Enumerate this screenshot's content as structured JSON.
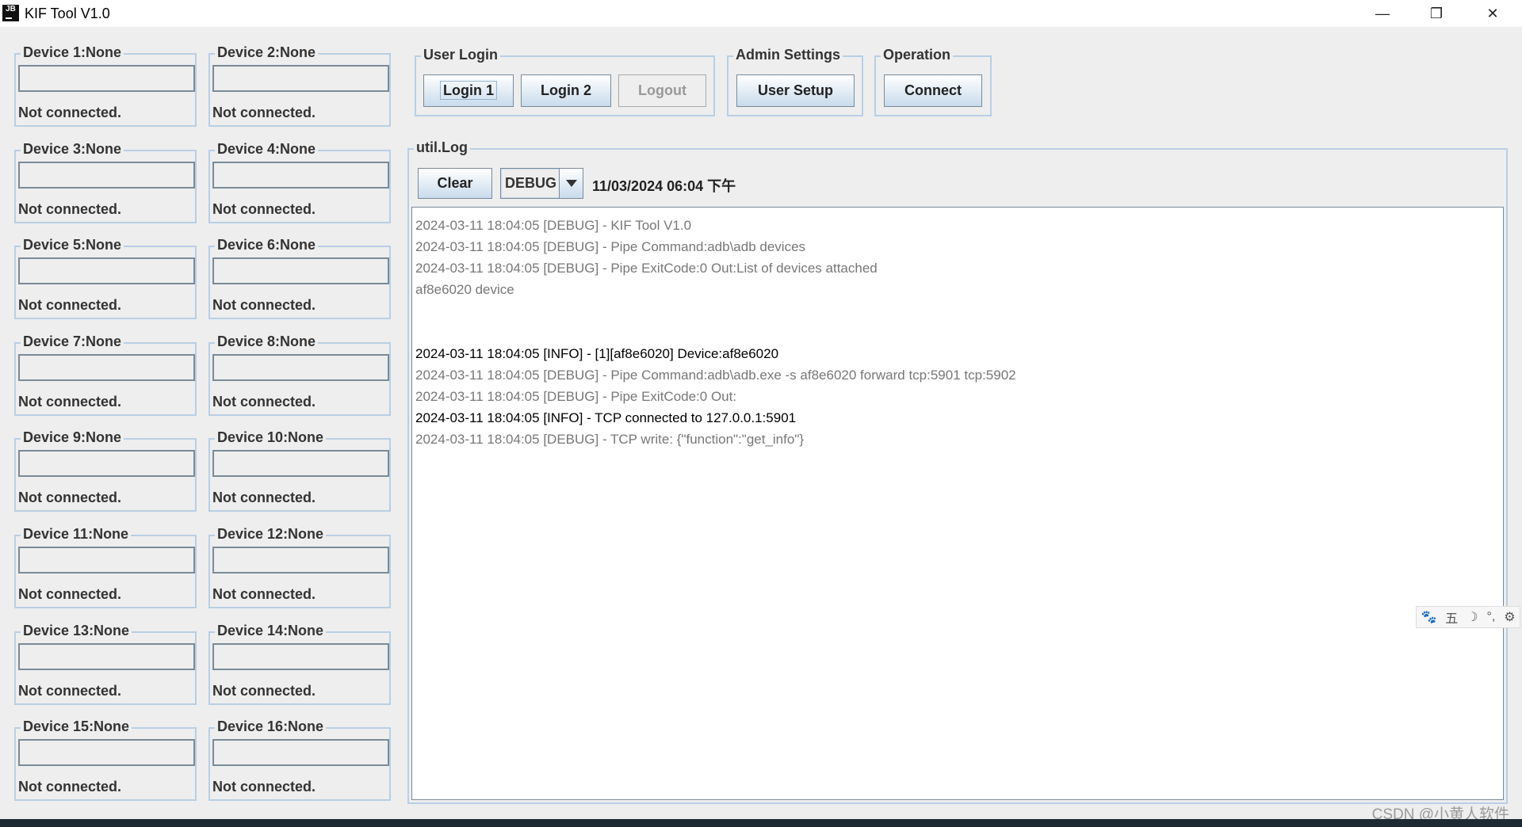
{
  "window": {
    "title": "KIF Tool V1.0",
    "app_icon": "JB",
    "controls": {
      "minimize": "—",
      "restore": "❐",
      "close": "✕"
    }
  },
  "devices": [
    {
      "title": "Device 1:None",
      "value": "",
      "status": "Not connected."
    },
    {
      "title": "Device 2:None",
      "value": "",
      "status": "Not connected."
    },
    {
      "title": "Device 3:None",
      "value": "",
      "status": "Not connected."
    },
    {
      "title": "Device 4:None",
      "value": "",
      "status": "Not connected."
    },
    {
      "title": "Device 5:None",
      "value": "",
      "status": "Not connected."
    },
    {
      "title": "Device 6:None",
      "value": "",
      "status": "Not connected."
    },
    {
      "title": "Device 7:None",
      "value": "",
      "status": "Not connected."
    },
    {
      "title": "Device 8:None",
      "value": "",
      "status": "Not connected."
    },
    {
      "title": "Device 9:None",
      "value": "",
      "status": "Not connected."
    },
    {
      "title": "Device 10:None",
      "value": "",
      "status": "Not connected."
    },
    {
      "title": "Device 11:None",
      "value": "",
      "status": "Not connected."
    },
    {
      "title": "Device 12:None",
      "value": "",
      "status": "Not connected."
    },
    {
      "title": "Device 13:None",
      "value": "",
      "status": "Not connected."
    },
    {
      "title": "Device 14:None",
      "value": "",
      "status": "Not connected."
    },
    {
      "title": "Device 15:None",
      "value": "",
      "status": "Not connected."
    },
    {
      "title": "Device 16:None",
      "value": "",
      "status": "Not connected."
    }
  ],
  "user_login": {
    "title": "User Login",
    "login1": "Login 1",
    "login2": "Login 2",
    "logout": "Logout"
  },
  "admin": {
    "title": "Admin Settings",
    "user_setup": "User Setup"
  },
  "operation": {
    "title": "Operation",
    "connect": "Connect"
  },
  "log": {
    "title": "util.Log",
    "clear": "Clear",
    "level": "DEBUG",
    "datetime": "11/03/2024 06:04 下午",
    "lines": [
      {
        "text": "2024-03-11 18:04:05 [DEBUG] - KIF Tool V1.0",
        "level": "debug"
      },
      {
        "text": "2024-03-11 18:04:05 [DEBUG] - Pipe Command:adb\\adb devices",
        "level": "debug"
      },
      {
        "text": "2024-03-11 18:04:05 [DEBUG] - Pipe ExitCode:0 Out:List of devices attached",
        "level": "debug"
      },
      {
        "text": "af8e6020\tdevice",
        "level": "debug"
      },
      {
        "text": "",
        "level": "debug"
      },
      {
        "text": "",
        "level": "debug"
      },
      {
        "text": "2024-03-11 18:04:05 [INFO] - [1][af8e6020] Device:af8e6020",
        "level": "info"
      },
      {
        "text": "2024-03-11 18:04:05 [DEBUG] - Pipe Command:adb\\adb.exe -s af8e6020 forward tcp:5901 tcp:5902",
        "level": "debug"
      },
      {
        "text": "2024-03-11 18:04:05 [DEBUG] - Pipe ExitCode:0 Out:",
        "level": "debug"
      },
      {
        "text": "2024-03-11 18:04:05 [INFO] - TCP connected to 127.0.0.1:5901",
        "level": "info"
      },
      {
        "text": "2024-03-11 18:04:05 [DEBUG] - TCP write: {\"function\":\"get_info\"}",
        "level": "debug"
      }
    ]
  },
  "ime_toolbar": {
    "icons": [
      "paw-icon",
      "wubi-icon",
      "moon-icon",
      "punctuation-icon",
      "gear-icon"
    ],
    "glyphs": [
      "🐾",
      "五",
      "☽",
      "°,",
      "⚙"
    ]
  },
  "watermark": "CSDN @小黄人软件"
}
